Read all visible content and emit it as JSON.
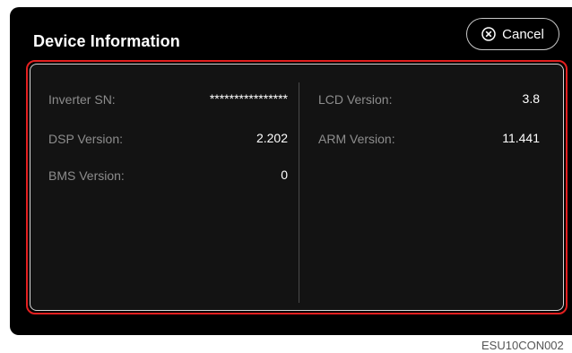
{
  "dialog": {
    "title": "Device Information",
    "cancel_label": "Cancel",
    "cancel_icon": "close-circle-icon"
  },
  "left_column": [
    {
      "label": "Inverter SN:",
      "value": "****************"
    },
    {
      "label": "DSP Version:",
      "value": "2.202"
    },
    {
      "label": "BMS Version:",
      "value": "0"
    }
  ],
  "right_column": [
    {
      "label": "LCD Version:",
      "value": "3.8"
    },
    {
      "label": "ARM Version:",
      "value": "11.441"
    }
  ],
  "figure_code": "ESU10CON002",
  "colors": {
    "background": "#000000",
    "panel_border": "#e32020",
    "label": "#8d8d8d",
    "value": "#ffffff"
  }
}
